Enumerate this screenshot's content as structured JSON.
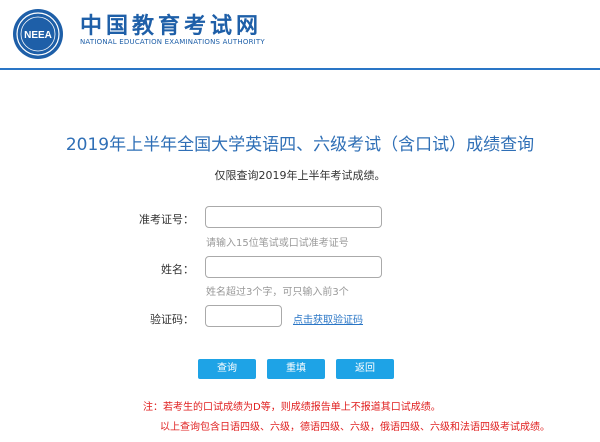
{
  "header": {
    "logo_text": "NEEA",
    "brand_cn": "中国教育考试网",
    "brand_en": "NATIONAL EDUCATION EXAMINATIONS AUTHORITY",
    "accent_color": "#1e5fa8"
  },
  "page": {
    "title": "2019年上半年全国大学英语四、六级考试（含口试）成绩查询",
    "subnote": "仅限查询2019年上半年考试成绩。"
  },
  "form": {
    "exam_id": {
      "label": "准考证号：",
      "value": "",
      "hint": "请输入15位笔试或口试准考证号"
    },
    "name": {
      "label": "姓名：",
      "value": "",
      "hint": "姓名超过3个字，可只输入前3个"
    },
    "captcha": {
      "label": "验证码：",
      "value": "",
      "link": "点击获取验证码"
    }
  },
  "buttons": {
    "query": "查询",
    "reset": "重填",
    "back": "返回",
    "color": "#1ea3e6"
  },
  "notes": {
    "line1": "注：若考生的口试成绩为D等，则成绩报告单上不报道其口试成绩。",
    "line2": "以上查询包含日语四级、六级，德语四级、六级，俄语四级、六级和法语四级考试成绩。",
    "color": "#e02020"
  }
}
